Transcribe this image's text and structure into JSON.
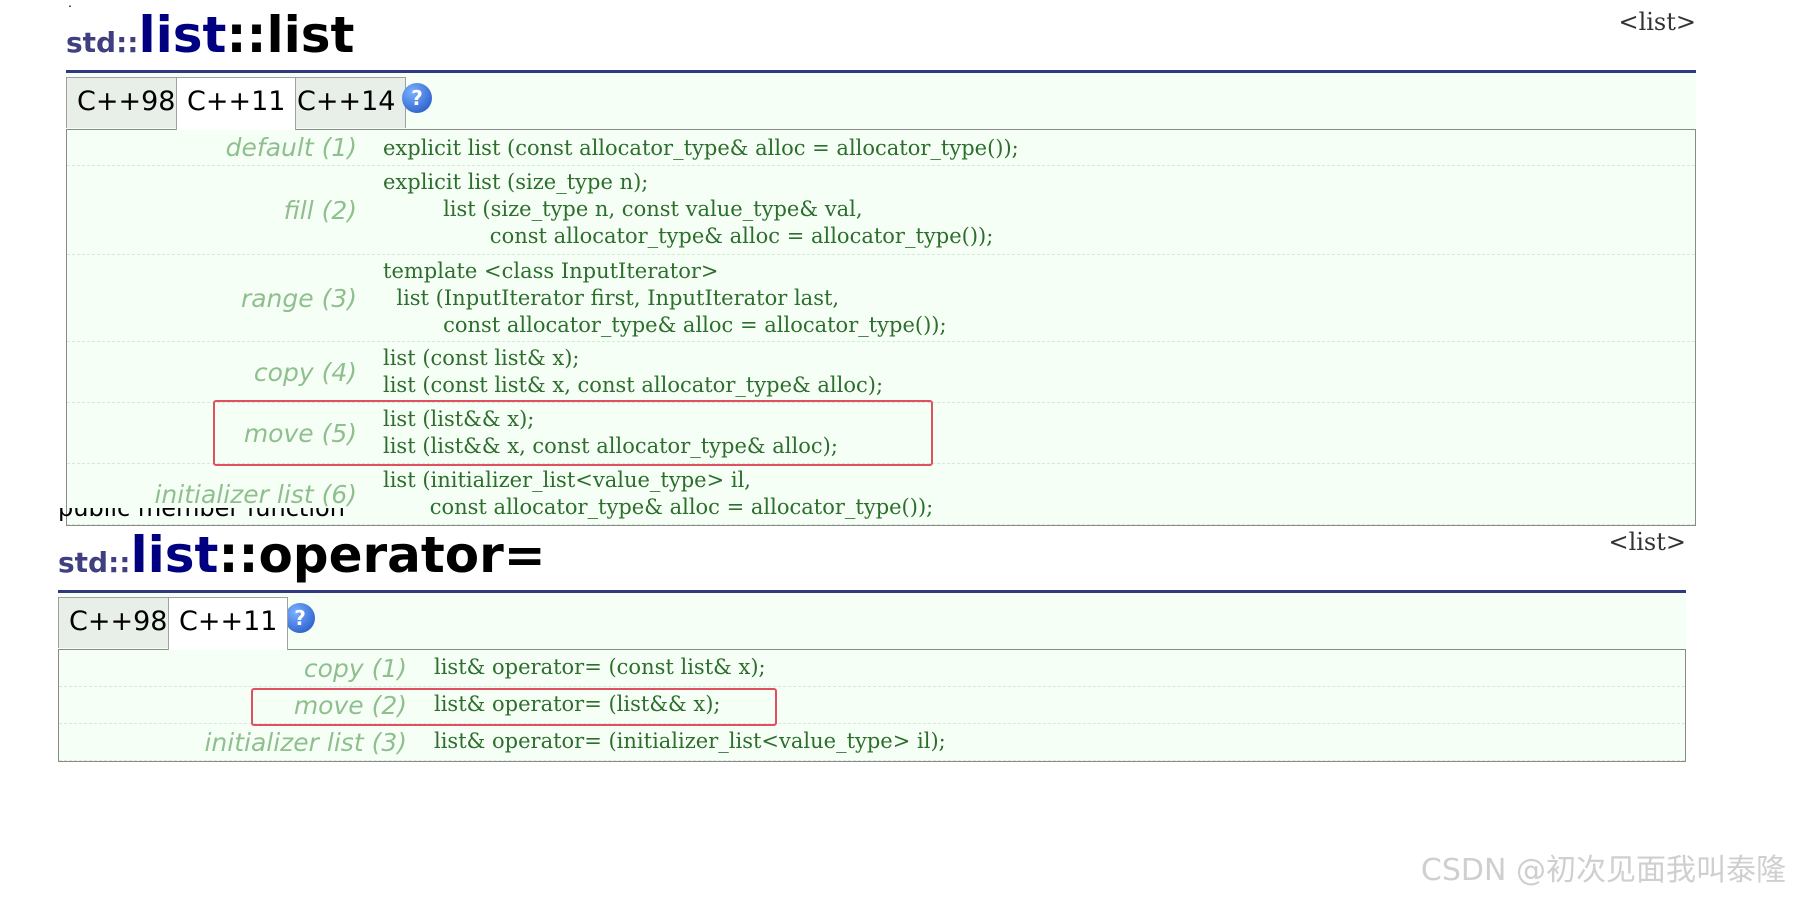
{
  "sections": [
    {
      "title_ns": "std::",
      "title_name": "list",
      "title_rest": "::list",
      "header_link": "<list>",
      "tabs": [
        "C++98",
        "C++11",
        "C++14"
      ],
      "help": "?",
      "rows": [
        {
          "label": "default (1)",
          "code": "explicit list (const allocator_type& alloc = allocator_type());"
        },
        {
          "label": "fill (2)",
          "code": "explicit list (size_type n);\n         list (size_type n, const value_type& val,\n                const allocator_type& alloc = allocator_type());"
        },
        {
          "label": "range (3)",
          "code": "template <class InputIterator>\n  list (InputIterator first, InputIterator last,\n         const allocator_type& alloc = allocator_type());"
        },
        {
          "label": "copy (4)",
          "code": "list (const list& x);\nlist (const list& x, const allocator_type& alloc);"
        },
        {
          "label": "move (5)",
          "code": "list (list&& x);\nlist (list&& x, const allocator_type& alloc);"
        },
        {
          "label": "initializer list (6)",
          "code": "list (initializer_list<value_type> il,\n       const allocator_type& alloc = allocator_type());"
        }
      ]
    },
    {
      "cut_text": "public member function",
      "title_ns": "std::",
      "title_name": "list",
      "title_rest": "::operator=",
      "header_link": "<list>",
      "tabs": [
        "C++98",
        "C++11"
      ],
      "help": "?",
      "rows": [
        {
          "label": "copy (1)",
          "code": "list& operator= (const list& x);"
        },
        {
          "label": "move (2)",
          "code": "list& operator= (list&& x);"
        },
        {
          "label": "initializer list (3)",
          "code": "list& operator= (initializer_list<value_type> il);"
        }
      ]
    }
  ],
  "watermark": "CSDN @初次见面我叫泰隆",
  "colors": {
    "highlight": "#e05060",
    "label": "#8fbf8f",
    "code": "#2c6e2c",
    "title": "#000080"
  }
}
